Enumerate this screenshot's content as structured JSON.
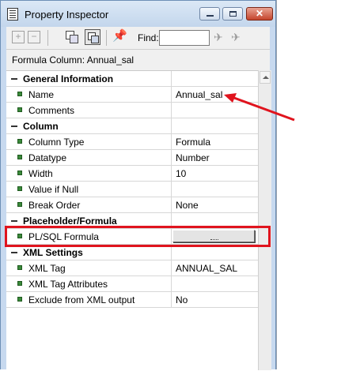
{
  "window": {
    "title": "Property Inspector"
  },
  "toolbar": {
    "find_label": "Find:",
    "find_value": ""
  },
  "context_label": "Formula Column: Annual_sal",
  "sections": [
    {
      "title": "General Information",
      "rows": [
        {
          "label": "Name",
          "value": "Annual_sal"
        },
        {
          "label": "Comments",
          "value": ""
        }
      ]
    },
    {
      "title": "Column",
      "rows": [
        {
          "label": "Column Type",
          "value": "Formula"
        },
        {
          "label": "Datatype",
          "value": "Number"
        },
        {
          "label": "Width",
          "value": "10"
        },
        {
          "label": "Value if Null",
          "value": ""
        },
        {
          "label": "Break Order",
          "value": "None"
        }
      ]
    },
    {
      "title": "Placeholder/Formula",
      "rows": [
        {
          "label": "PL/SQL Formula",
          "value": ""
        }
      ]
    },
    {
      "title": "XML Settings",
      "rows": [
        {
          "label": "XML Tag",
          "value": "ANNUAL_SAL"
        },
        {
          "label": "XML Tag Attributes",
          "value": ""
        },
        {
          "label": "Exclude from XML output",
          "value": "No"
        }
      ]
    }
  ],
  "annotation_color": "#e0141e"
}
